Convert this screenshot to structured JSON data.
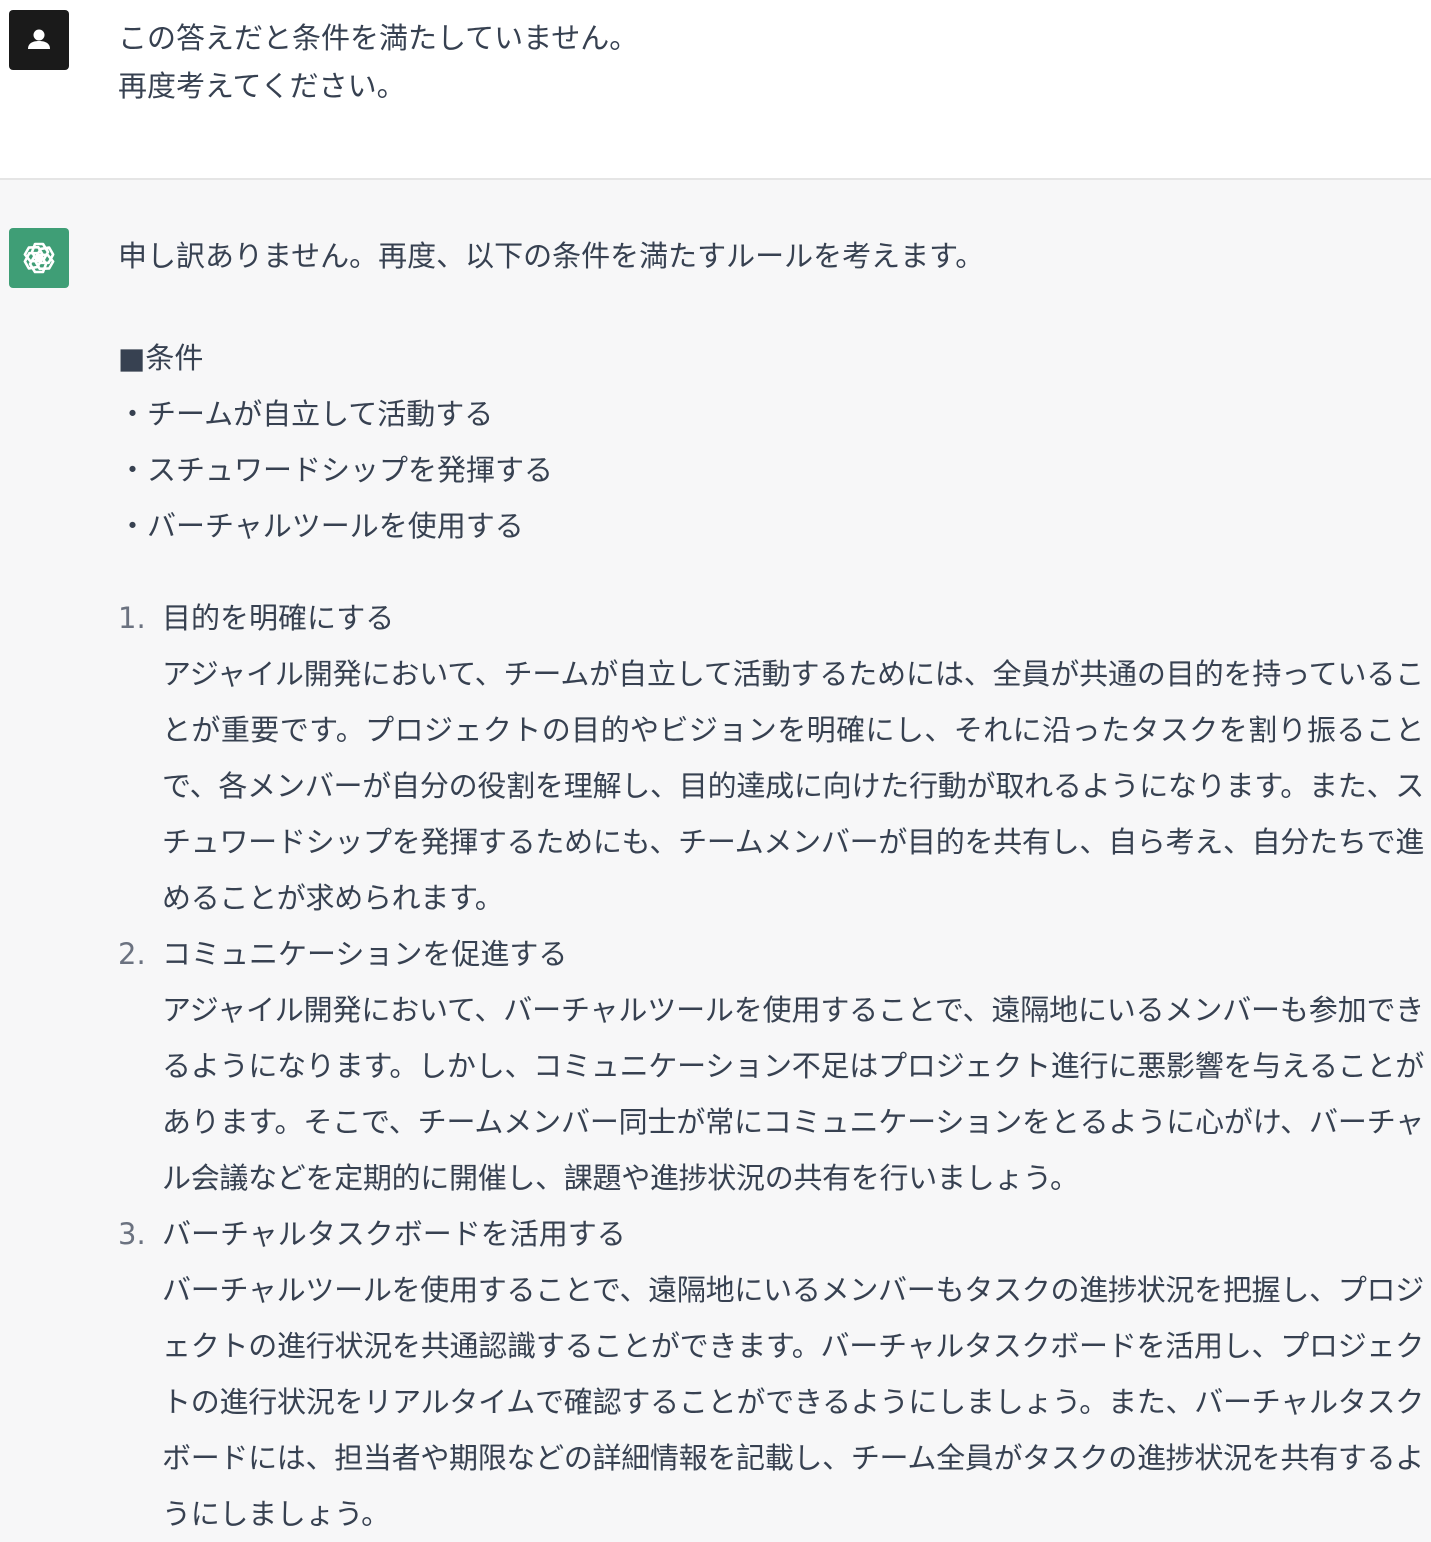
{
  "user_message": {
    "lines": [
      "この答えだと条件を満たしていません。",
      "再度考えてください。"
    ]
  },
  "assistant_message": {
    "intro": "申し訳ありません。再度、以下の条件を満たすルールを考えます。",
    "conditions": {
      "heading": "■条件",
      "items": [
        "・チームが自立して活動する",
        "・スチュワードシップを発揮する",
        "・バーチャルツールを使用する"
      ]
    },
    "list": [
      {
        "num": "1.",
        "title": "目的を明確にする",
        "body": "アジャイル開発において、チームが自立して活動するためには、全員が共通の目的を持っていることが重要です。プロジェクトの目的やビジョンを明確にし、それに沿ったタスクを割り振ることで、各メンバーが自分の役割を理解し、目的達成に向けた行動が取れるようになります。また、スチュワードシップを発揮するためにも、チームメンバーが目的を共有し、自ら考え、自分たちで進めることが求められます。"
      },
      {
        "num": "2.",
        "title": "コミュニケーションを促進する",
        "body": "アジャイル開発において、バーチャルツールを使用することで、遠隔地にいるメンバーも参加できるようになります。しかし、コミュニケーション不足はプロジェクト進行に悪影響を与えることがあります。そこで、チームメンバー同士が常にコミュニケーションをとるように心がけ、バーチャル会議などを定期的に開催し、課題や進捗状況の共有を行いましょう。"
      },
      {
        "num": "3.",
        "title": "バーチャルタスクボードを活用する",
        "body": "バーチャルツールを使用することで、遠隔地にいるメンバーもタスクの進捗状況を把握し、プロジェクトの進行状況を共通認識することができます。バーチャルタスクボードを活用し、プロジェクトの進行状況をリアルタイムで確認することができるようにしましょう。また、バーチャルタスクボードには、担当者や期限などの詳細情報を記載し、チーム全員がタスクの進捗状況を共有するようにしましょう。"
      }
    ]
  },
  "icons": {
    "user_avatar": "user-silhouette-icon",
    "assistant_avatar": "openai-logo-icon"
  },
  "colors": {
    "user_bg": "#ffffff",
    "assistant_bg": "#f7f7f8",
    "user_avatar_bg": "#1a1a1a",
    "assistant_avatar_bg": "#3f9e76",
    "text": "#374151"
  }
}
